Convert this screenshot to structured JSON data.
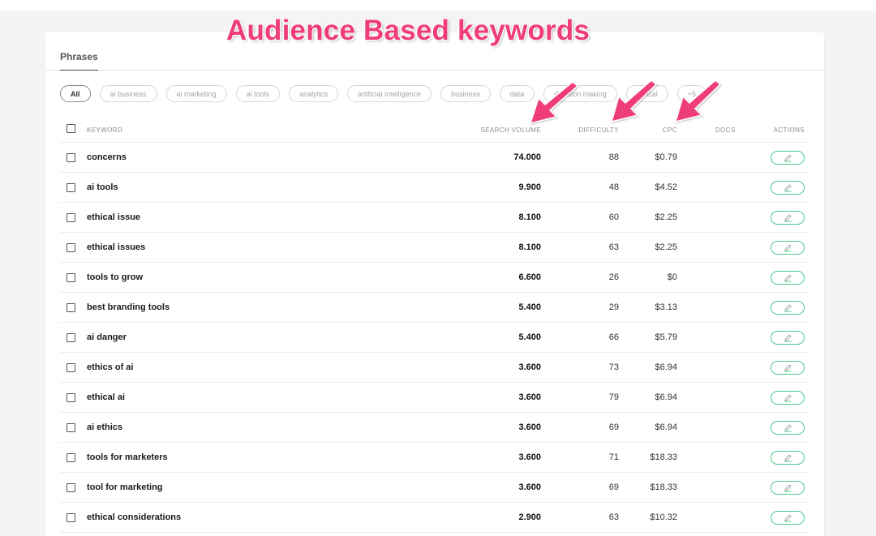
{
  "annotation": {
    "title": "Audience Based keywords",
    "color": "#ee3d78"
  },
  "tabs": [
    {
      "label": "Phrases",
      "active": true
    }
  ],
  "filters": [
    {
      "label": "All",
      "active": true
    },
    {
      "label": "ai business"
    },
    {
      "label": "ai marketing"
    },
    {
      "label": "ai tools"
    },
    {
      "label": "analytics"
    },
    {
      "label": "artificial intelligence"
    },
    {
      "label": "business"
    },
    {
      "label": "data"
    },
    {
      "label": "decision making"
    },
    {
      "label": "ethical"
    },
    {
      "label": "+5"
    }
  ],
  "table": {
    "columns": {
      "keyword": "KEYWORD",
      "search_volume": "SEARCH VOLUME",
      "difficulty": "DIFFICULTY",
      "cpc": "CPC",
      "docs": "DOCS",
      "actions": "ACTIONS"
    },
    "rows": [
      {
        "keyword": "concerns",
        "volume": "74.000",
        "difficulty": "88",
        "cpc": "$0.79"
      },
      {
        "keyword": "ai tools",
        "volume": "9.900",
        "difficulty": "48",
        "cpc": "$4.52"
      },
      {
        "keyword": "ethical issue",
        "volume": "8.100",
        "difficulty": "60",
        "cpc": "$2.25"
      },
      {
        "keyword": "ethical issues",
        "volume": "8.100",
        "difficulty": "63",
        "cpc": "$2.25"
      },
      {
        "keyword": "tools to grow",
        "volume": "6.600",
        "difficulty": "26",
        "cpc": "$0"
      },
      {
        "keyword": "best branding tools",
        "volume": "5.400",
        "difficulty": "29",
        "cpc": "$3.13"
      },
      {
        "keyword": "ai danger",
        "volume": "5.400",
        "difficulty": "66",
        "cpc": "$5.79"
      },
      {
        "keyword": "ethics of ai",
        "volume": "3.600",
        "difficulty": "73",
        "cpc": "$6.94"
      },
      {
        "keyword": "ethical ai",
        "volume": "3.600",
        "difficulty": "79",
        "cpc": "$6.94"
      },
      {
        "keyword": "ai ethics",
        "volume": "3.600",
        "difficulty": "69",
        "cpc": "$6.94"
      },
      {
        "keyword": "tools for marketers",
        "volume": "3.600",
        "difficulty": "71",
        "cpc": "$18.33"
      },
      {
        "keyword": "tool for marketing",
        "volume": "3.600",
        "difficulty": "69",
        "cpc": "$18.33"
      },
      {
        "keyword": "ethical considerations",
        "volume": "2.900",
        "difficulty": "63",
        "cpc": "$10.32"
      }
    ]
  },
  "icons": {
    "row_action": "pencil-icon",
    "annotation_pointer": "arrow-icon"
  },
  "colors": {
    "action_border": "#4cc98a",
    "annotation": "#ee3d78"
  }
}
